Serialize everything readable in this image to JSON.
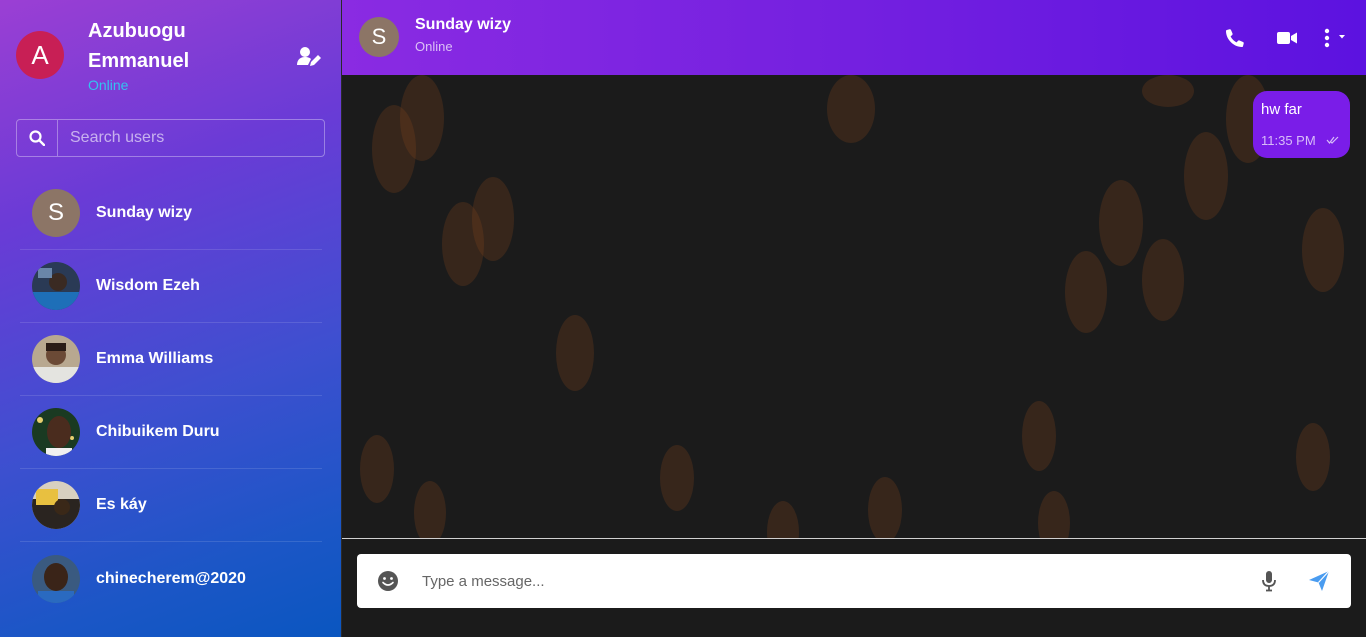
{
  "current_user": {
    "initial": "A",
    "name": "Azubuogu Emmanuel",
    "status": "Online"
  },
  "search": {
    "placeholder": "Search users"
  },
  "contacts": [
    {
      "name": "Sunday wizy",
      "initial": "S",
      "avatar": "initial"
    },
    {
      "name": "Wisdom Ezeh",
      "avatar": "photo"
    },
    {
      "name": "Emma Williams",
      "avatar": "photo"
    },
    {
      "name": "Chibuikem Duru",
      "avatar": "photo"
    },
    {
      "name": "Es káy",
      "avatar": "photo"
    },
    {
      "name": "chinecherem@2020",
      "avatar": "photo"
    }
  ],
  "chat": {
    "initial": "S",
    "name": "Sunday wizy",
    "status": "Online"
  },
  "messages": [
    {
      "text": "hw far",
      "time": "11:35 PM",
      "direction": "outgoing",
      "status": "read"
    }
  ],
  "composer": {
    "placeholder": "Type a message..."
  },
  "icons": {
    "add_user": "user-edit-icon",
    "search": "search-icon",
    "call": "phone-icon",
    "video": "video-icon",
    "menu": "more-vertical-icon",
    "emoji": "smile-icon",
    "mic": "microphone-icon",
    "send": "paper-plane-icon"
  },
  "colors": {
    "accent": "#7a1de8",
    "online": "#34c3ef",
    "send_icon": "#4a9cf0"
  }
}
